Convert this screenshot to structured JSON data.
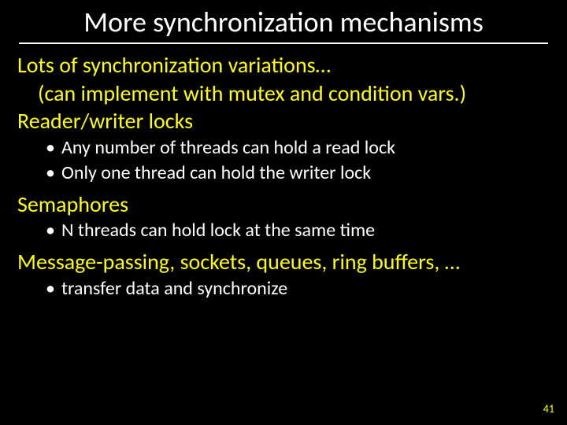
{
  "title": "More synchronization mechanisms",
  "intro1": "Lots of synchronization variations…",
  "intro2": "(can implement with mutex and condition vars.)",
  "rw_heading": "Reader/writer locks",
  "rw_b1": "Any number of threads can hold a read lock",
  "rw_b2": "Only one thread can hold the writer lock",
  "sem_heading": "Semaphores",
  "sem_b1": "N threads can hold lock at the same time",
  "mp_heading": "Message-passing, sockets, queues, ring buffers, …",
  "mp_b1": "transfer data and synchronize",
  "page": "41"
}
